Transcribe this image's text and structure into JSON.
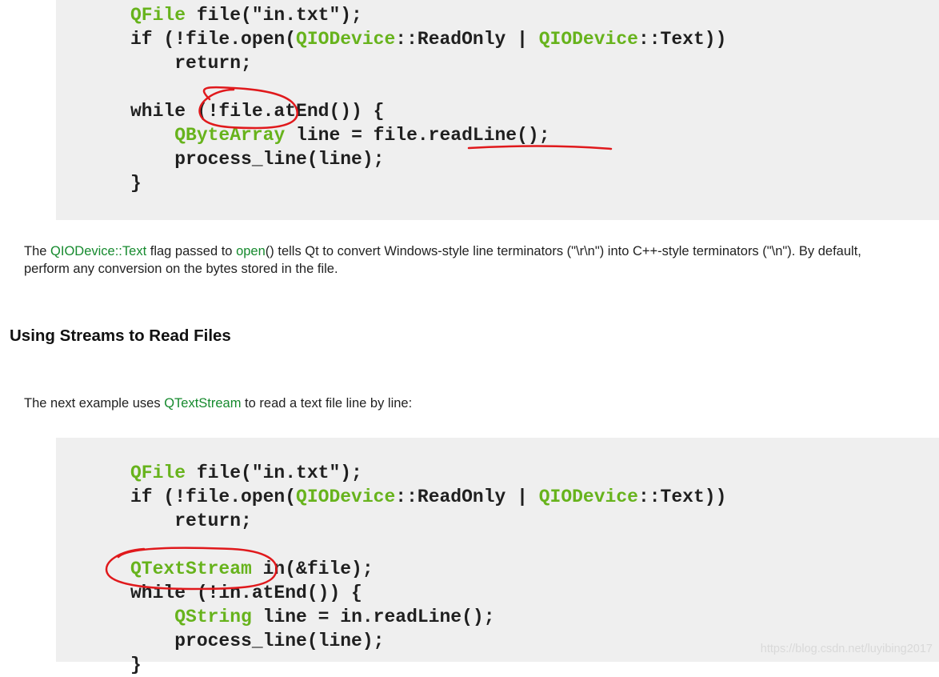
{
  "code_block_1": {
    "lines": [
      [
        {
          "t": "QFile",
          "g": true
        },
        {
          "t": " file(\"in.txt\");"
        }
      ],
      [
        {
          "t": "if (!file.open("
        },
        {
          "t": "QIODevice",
          "g": true
        },
        {
          "t": "::ReadOnly | "
        },
        {
          "t": "QIODevice",
          "g": true
        },
        {
          "t": "::Text))"
        }
      ],
      [
        {
          "t": "    return;"
        }
      ],
      [
        {
          "t": ""
        }
      ],
      [
        {
          "t": "while (!file.atEnd()) {"
        }
      ],
      [
        {
          "t": "    "
        },
        {
          "t": "QByteArray",
          "g": true
        },
        {
          "t": " line = file.readLine();"
        }
      ],
      [
        {
          "t": "    process_line(line);"
        }
      ],
      [
        {
          "t": "}"
        }
      ]
    ]
  },
  "paragraph_1": {
    "line1_prefix": "The ",
    "link_qiodevice_text": "QIODevice::Text",
    "line1_mid1": " flag passed to ",
    "link_open": "open",
    "line1_suffix": "() tells Qt to convert Windows-style line terminators (\"\\r\\n\") into C++-style terminators (\"\\n\"). By default,",
    "line2": "perform any conversion on the bytes stored in the file."
  },
  "heading": "Using Streams to Read Files",
  "paragraph_2": {
    "prefix": "The next example uses ",
    "link_qtextstream": "QTextStream",
    "suffix": " to read a text file line by line:"
  },
  "code_block_2": {
    "lines": [
      [
        {
          "t": "QFile",
          "g": true
        },
        {
          "t": " file(\"in.txt\");"
        }
      ],
      [
        {
          "t": "if (!file.open("
        },
        {
          "t": "QIODevice",
          "g": true
        },
        {
          "t": "::ReadOnly | "
        },
        {
          "t": "QIODevice",
          "g": true
        },
        {
          "t": "::Text))"
        }
      ],
      [
        {
          "t": "    return;"
        }
      ],
      [
        {
          "t": ""
        }
      ],
      [
        {
          "t": "QTextStream",
          "g": true
        },
        {
          "t": " in(&file);"
        }
      ],
      [
        {
          "t": "while (!in.atEnd()) {"
        }
      ],
      [
        {
          "t": "    "
        },
        {
          "t": "QString",
          "g": true
        },
        {
          "t": " line = in.readLine();"
        }
      ],
      [
        {
          "t": "    process_line(line);"
        }
      ],
      [
        {
          "t": "}"
        }
      ]
    ]
  },
  "watermark": "https://blog.csdn.net/luyibing2017",
  "colors": {
    "code_keyword_green": "#67b31c",
    "link_green": "#168a2e",
    "annotation_red": "#e0191c",
    "code_background": "#efefef"
  }
}
